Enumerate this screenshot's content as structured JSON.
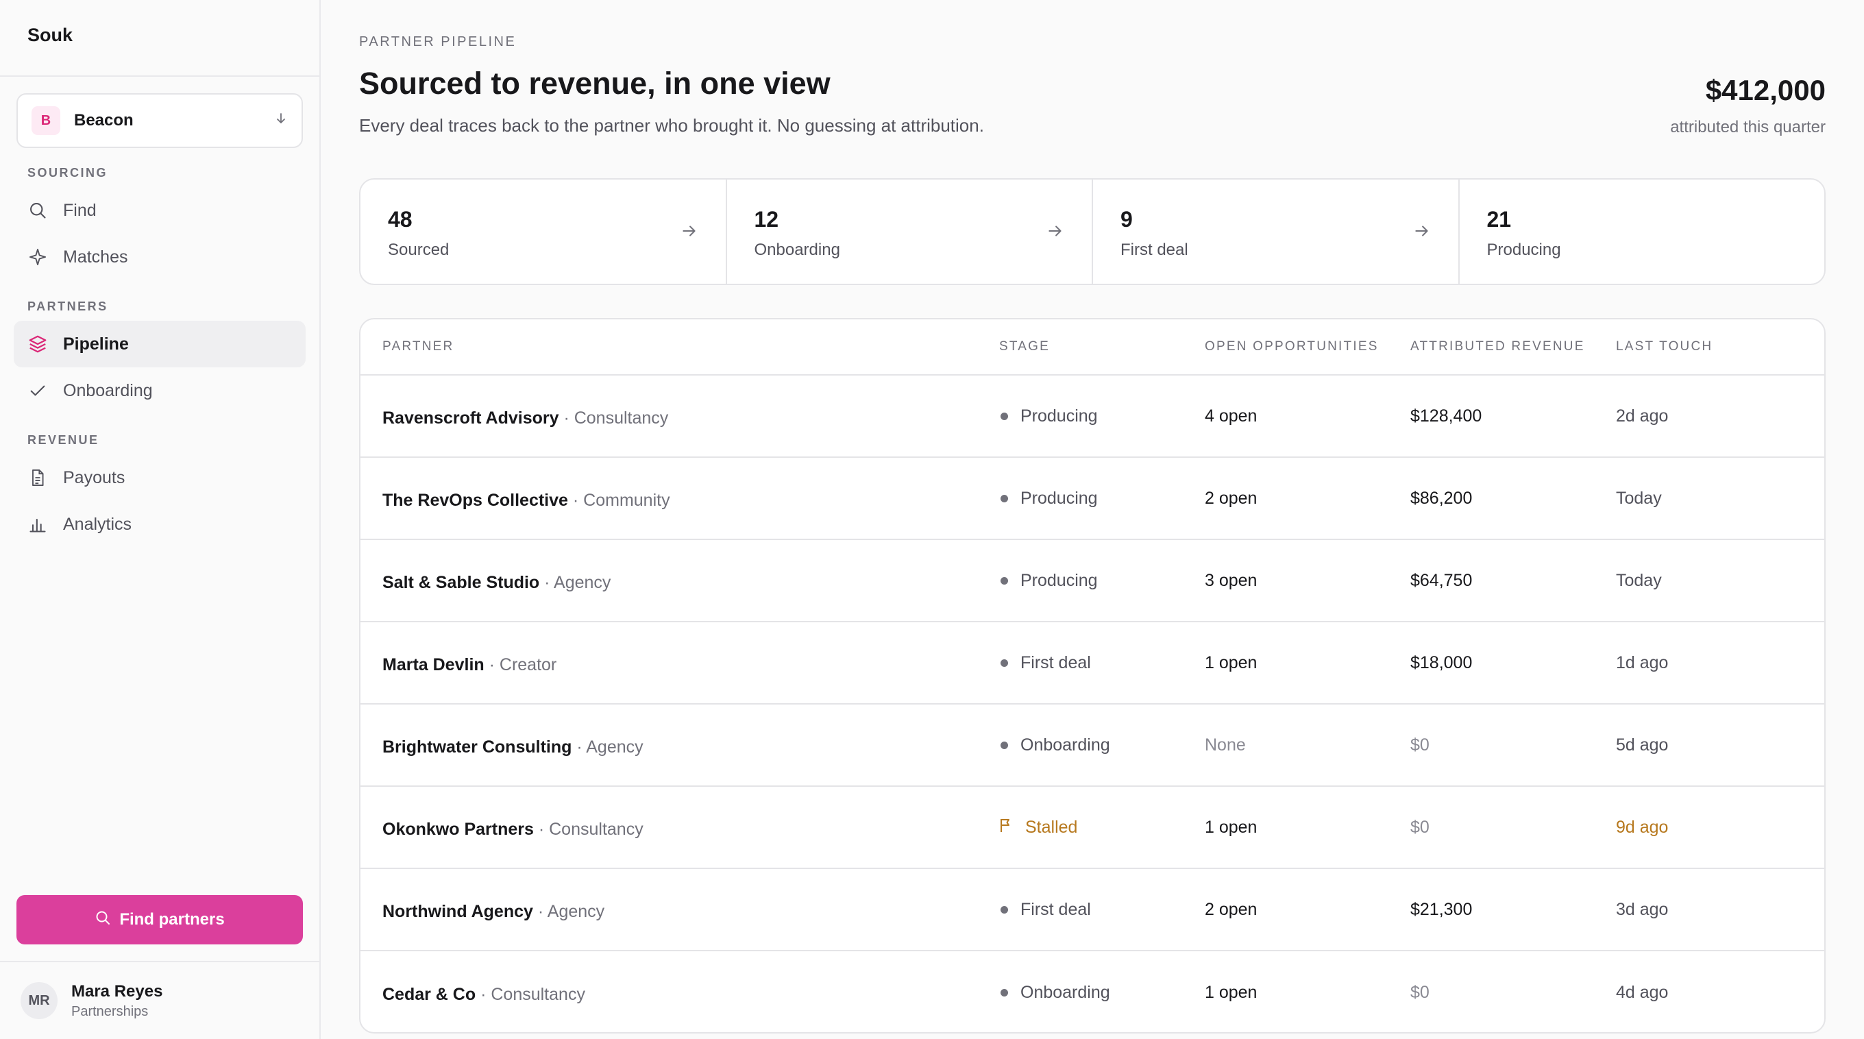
{
  "sidebar": {
    "brand": "Souk",
    "workspace": {
      "badge": "B",
      "name": "Beacon"
    },
    "sections": [
      {
        "label": "SOURCING",
        "items": [
          {
            "label": "Find",
            "icon": "search-icon"
          },
          {
            "label": "Matches",
            "icon": "sparkle-icon"
          }
        ]
      },
      {
        "label": "PARTNERS",
        "items": [
          {
            "label": "Pipeline",
            "icon": "layers-icon",
            "active": true
          },
          {
            "label": "Onboarding",
            "icon": "check-icon"
          }
        ]
      },
      {
        "label": "REVENUE",
        "items": [
          {
            "label": "Payouts",
            "icon": "document-icon"
          },
          {
            "label": "Analytics",
            "icon": "bar-chart-icon"
          }
        ]
      }
    ],
    "cta": "Find partners",
    "user": {
      "initials": "MR",
      "name": "Mara Reyes",
      "role": "Partnerships"
    }
  },
  "header": {
    "eyebrow": "PARTNER PIPELINE",
    "title": "Sourced to revenue, in one view",
    "subtitle": "Every deal traces back to the partner who brought it. No guessing at attribution.",
    "kpi_value": "$412,000",
    "kpi_label": "attributed this quarter"
  },
  "stages": [
    {
      "count": "48",
      "label": "Sourced"
    },
    {
      "count": "12",
      "label": "Onboarding"
    },
    {
      "count": "9",
      "label": "First deal"
    },
    {
      "count": "21",
      "label": "Producing"
    }
  ],
  "table": {
    "columns": [
      "PARTNER",
      "STAGE",
      "OPEN OPPORTUNITIES",
      "ATTRIBUTED REVENUE",
      "LAST TOUCH"
    ],
    "rows": [
      {
        "name": "Ravenscroft Advisory",
        "type": "· Consultancy",
        "stage": "Producing",
        "open": "4 open",
        "revenue": "$128,400",
        "touch": "2d ago"
      },
      {
        "name": "The RevOps Collective",
        "type": "· Community",
        "stage": "Producing",
        "open": "2 open",
        "revenue": "$86,200",
        "touch": "Today"
      },
      {
        "name": "Salt & Sable Studio",
        "type": "· Agency",
        "stage": "Producing",
        "open": "3 open",
        "revenue": "$64,750",
        "touch": "Today"
      },
      {
        "name": "Marta Devlin",
        "type": "· Creator",
        "stage": "First deal",
        "open": "1 open",
        "revenue": "$18,000",
        "touch": "1d ago"
      },
      {
        "name": "Brightwater Consulting",
        "type": "· Agency",
        "stage": "Onboarding",
        "open": "None",
        "revenue": "$0",
        "touch": "5d ago"
      },
      {
        "name": "Okonkwo Partners",
        "type": "· Consultancy",
        "stage": "Stalled",
        "open": "1 open",
        "revenue": "$0",
        "touch": "9d ago"
      },
      {
        "name": "Northwind Agency",
        "type": "· Agency",
        "stage": "First deal",
        "open": "2 open",
        "revenue": "$21,300",
        "touch": "3d ago"
      },
      {
        "name": "Cedar & Co",
        "type": "· Consultancy",
        "stage": "Onboarding",
        "open": "1 open",
        "revenue": "$0",
        "touch": "4d ago"
      }
    ]
  },
  "colors": {
    "accent": "#db3f9c",
    "warning": "#b7791f"
  }
}
